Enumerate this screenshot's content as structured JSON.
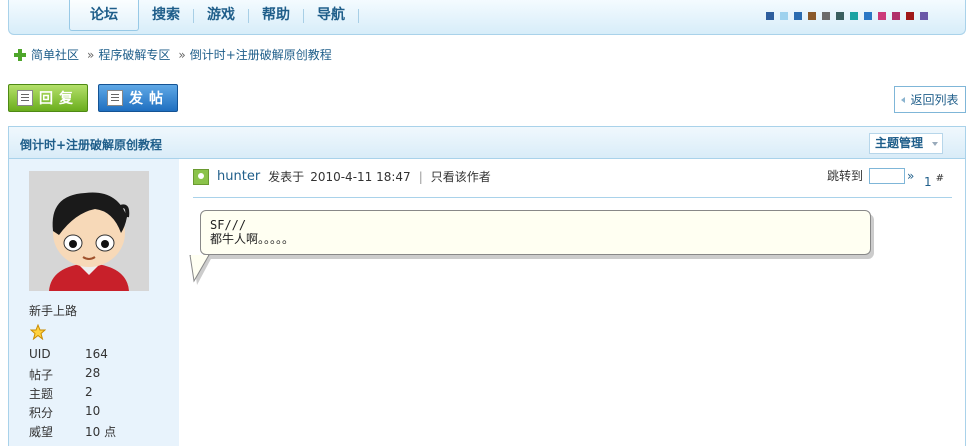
{
  "nav": {
    "items": [
      {
        "label": "论坛",
        "active": true
      },
      {
        "label": "搜索"
      },
      {
        "label": "游戏"
      },
      {
        "label": "帮助"
      },
      {
        "label": "导航"
      }
    ],
    "theme_colors": [
      "#2e5e9e",
      "#9ed2ee",
      "#2b6cb0",
      "#8a5a2b",
      "#6b6b6b",
      "#3a5f5f",
      "#19a3a3",
      "#2a78c6",
      "#cc3a7a",
      "#b0306a",
      "#a01818",
      "#6a58a8"
    ]
  },
  "breadcrumb": {
    "items": [
      "简单社区",
      "程序破解专区",
      "倒计时+注册破解原创教程"
    ],
    "separator": "»"
  },
  "actions": {
    "reply_label": "回复",
    "post_label": "发帖",
    "back_label": "返回列表"
  },
  "thread": {
    "title": "倒计时+注册破解原创教程",
    "manage_label": "主题管理"
  },
  "user": {
    "title": "新手上路",
    "stats": [
      {
        "key": "UID",
        "value": "164"
      },
      {
        "key": "帖子",
        "value": "28"
      },
      {
        "key": "主题",
        "value": "2"
      },
      {
        "key": "积分",
        "value": "10"
      },
      {
        "key": "威望",
        "value": "10 点"
      }
    ]
  },
  "post": {
    "author": "hunter",
    "posted_prefix": "发表于",
    "datetime": "2010-4-11 18:47",
    "meta_sep": "|",
    "only_author": "只看该作者",
    "jump_label": "跳转到",
    "jump_go": "»",
    "floor": "1",
    "floor_mark": "#",
    "content": "SF///\n都牛人啊。。。。。"
  }
}
